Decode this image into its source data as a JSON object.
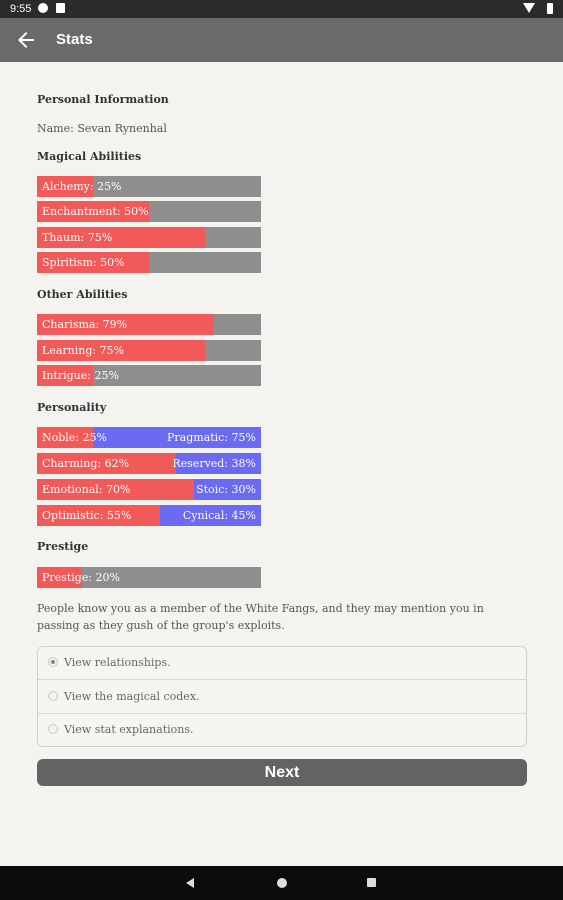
{
  "status": {
    "time": "9:55"
  },
  "appbar": {
    "title": "Stats"
  },
  "personal": {
    "heading": "Personal Information",
    "name_line": "Name: Sevan Rynenhal"
  },
  "magical": {
    "heading": "Magical Abilities",
    "items": [
      {
        "label": "Alchemy: 25%",
        "percent": 25
      },
      {
        "label": "Enchantment: 50%",
        "percent": 50
      },
      {
        "label": "Thaum: 75%",
        "percent": 75
      },
      {
        "label": "Spiritism: 50%",
        "percent": 50
      }
    ]
  },
  "other": {
    "heading": "Other Abilities",
    "items": [
      {
        "label": "Charisma: 79%",
        "percent": 79
      },
      {
        "label": "Learning: 75%",
        "percent": 75
      },
      {
        "label": "Intrigue: 25%",
        "percent": 25
      }
    ]
  },
  "personality": {
    "heading": "Personality",
    "items": [
      {
        "left": "Noble: 25%",
        "right": "Pragmatic: 75%",
        "left_percent": 25
      },
      {
        "left": "Charming: 62%",
        "right": "Reserved: 38%",
        "left_percent": 62
      },
      {
        "left": "Emotional: 70%",
        "right": "Stoic: 30%",
        "left_percent": 70
      },
      {
        "left": "Optimistic: 55%",
        "right": "Cynical: 45%",
        "left_percent": 55
      }
    ]
  },
  "prestige": {
    "heading": "Prestige",
    "label": "Prestige: 20%",
    "percent": 20
  },
  "description": "People know you as a member of the White Fangs, and they may mention you in passing as they gush of the group's exploits.",
  "choices": [
    {
      "label": "View relationships.",
      "selected": true
    },
    {
      "label": "View the magical codex.",
      "selected": false
    },
    {
      "label": "View stat explanations.",
      "selected": false
    }
  ],
  "next_label": "Next",
  "colors": {
    "primary_fill": "#f25a5a",
    "secondary_fill": "#6a6af2",
    "track": "#8e8e8e"
  }
}
